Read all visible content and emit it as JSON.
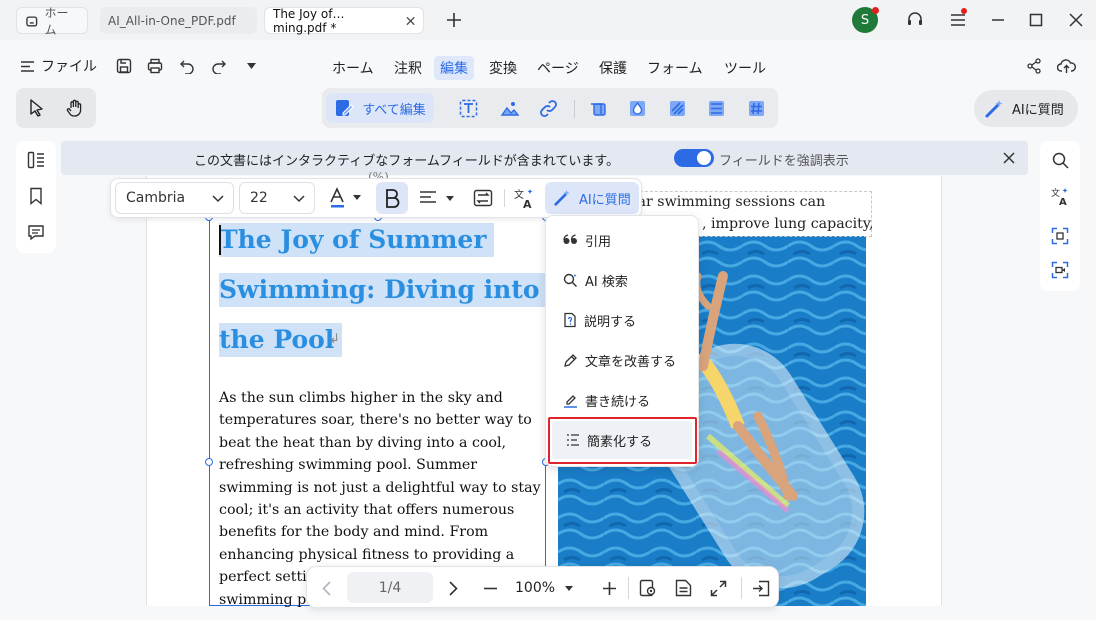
{
  "tabs": {
    "home_label": "ホーム",
    "tab1_label": "AI_All-in-One_PDF.pdf",
    "tab2_label": "The Joy of…ming.pdf *",
    "avatar_initial": "S"
  },
  "menubar": {
    "file_label": "ファイル",
    "items": [
      "ホーム",
      "注釈",
      "編集",
      "変換",
      "ページ",
      "保護",
      "フォーム",
      "ツール"
    ],
    "active_index": 2
  },
  "toolbar": {
    "edit_all_label": "すべて編集",
    "ai_ask_label": "AIに質問"
  },
  "banner": {
    "message": "この文書にはインタラクティブなフォームフィールドが含まれています。",
    "toggle_label": "フィールドを強調表示",
    "toggle_on": true
  },
  "format_bar": {
    "font_name": "Cambria",
    "font_size": "22",
    "ai_label": "AIに質問"
  },
  "context_menu": {
    "items": [
      "引用",
      "AI 検索",
      "説明する",
      "文章を改善する",
      "書き続ける",
      "簡素化する"
    ],
    "highlighted_index": 5
  },
  "document": {
    "heading_lines": [
      "The Joy of Summer",
      "Swimming: Diving into",
      "the Pool"
    ],
    "body_lines": [
      "As the sun climbs higher in the sky and",
      "temperatures soar, there's no better way to",
      "beat the heat than by diving into a cool,",
      "refreshing swimming pool. Summer",
      "swimming is not just a delightful way to stay",
      "cool; it's an activity that offers numerous",
      "benefits for the body and mind. From",
      "enhancing physical fitness to providing a",
      "perfect settin",
      "swimming po"
    ],
    "right_col_lines": [
      "lar swimming sessions can",
      ", improve lung capacity,"
    ],
    "top_partial": "(%)"
  },
  "bottom_bar": {
    "page_display": "1/4",
    "zoom": "100%"
  },
  "colors": {
    "accent": "#2d6be4",
    "heading": "#2a8fe0",
    "highlight_box": "#e0242b"
  }
}
